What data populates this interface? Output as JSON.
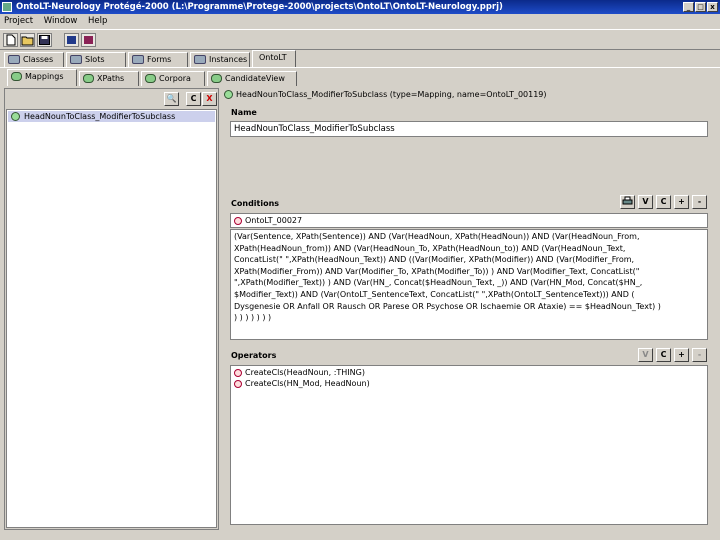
{
  "window": {
    "title": "OntoLT-Neurology  Protégé-2000   (L:\\Programme\\Protege-2000\\projects\\OntoLT\\OntoLT-Neurology.pprj)",
    "min": "_",
    "max": "□",
    "close": "x"
  },
  "menu": [
    "Project",
    "Window",
    "Help"
  ],
  "main_tabs": [
    {
      "label": "Classes"
    },
    {
      "label": "Slots"
    },
    {
      "label": "Forms"
    },
    {
      "label": "Instances"
    },
    {
      "label": "OntoLT",
      "selected": true
    }
  ],
  "sub_tabs": [
    {
      "label": "Mappings",
      "selected": true
    },
    {
      "label": "XPaths"
    },
    {
      "label": "Corpora"
    },
    {
      "label": "CandidateView"
    }
  ],
  "left": {
    "buttons": {
      "find": "🔍",
      "create": "C",
      "delete": "X"
    },
    "items": [
      "HeadNounToClass_ModifierToSubclass"
    ]
  },
  "right": {
    "header": "HeadNounToClass_ModifierToSubclass      (type=Mapping, name=OntoLT_00119)",
    "name_label": "Name",
    "name_value": "HeadNounToClass_ModifierToSubclass",
    "conditions_label": "Conditions",
    "conditions_buttons": [
      "V",
      "C",
      "+",
      "-"
    ],
    "condition_ref": "OntoLT_00027",
    "condition_lines": [
      "(Var(Sentence, XPath(Sentence)) AND (Var(HeadNoun, XPath(HeadNoun)) AND (Var(HeadNoun_From,",
      "XPath(HeadNoun_from)) AND (Var(HeadNoun_To, XPath(HeadNoun_to)) AND (Var(HeadNoun_Text,",
      "ConcatList(\" \",XPath(HeadNoun_Text)) AND ((Var(Modifier, XPath(Modifier)) AND (Var(Modifier_From,",
      "XPath(Modifier_From)) AND Var(Modifier_To, XPath(Modifier_To)) ) AND Var(Modifier_Text, ConcatList(\"",
      "\",XPath(Modifier_Text)) ) AND (Var(HN_, Concat($HeadNoun_Text, _)) AND (Var(HN_Mod, Concat($HN_,",
      "$Modifier_Text)) AND (Var(OntoLT_SentenceText, ConcatList(\" \",XPath(OntoLT_SentenceText))) AND (",
      "Dysgenesie OR Anfall OR Rausch OR Parese OR Psychose OR Ischaemie OR Ataxie) == $HeadNoun_Text) )",
      ") ) ) ) ) ) )"
    ],
    "operators_label": "Operators",
    "operators_buttons": [
      "V",
      "C",
      "+",
      "-"
    ],
    "operators": [
      "CreateCls(HeadNoun, :THING)",
      "CreateCls(HN_Mod, HeadNoun)"
    ]
  }
}
